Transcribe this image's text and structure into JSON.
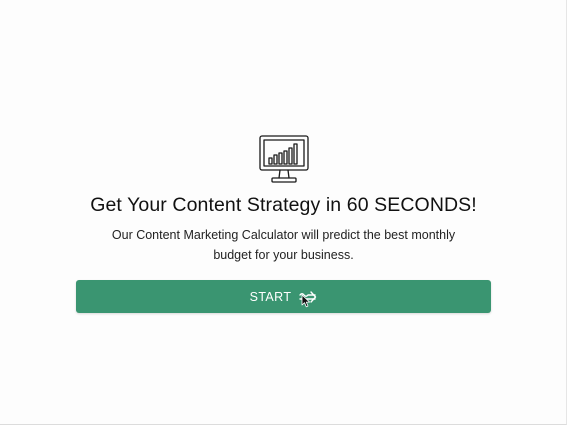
{
  "hero": {
    "icon": "monitor-chart-icon",
    "headline": "Get Your Content Strategy in 60 SECONDS!",
    "subtext": "Our Content Marketing Calculator will predict the best monthly budget for your business."
  },
  "start_button": {
    "label": "START",
    "icon": "arrow-right-icon",
    "color": "#3a9571"
  },
  "cursor": {
    "icon": "mouse-pointer-icon"
  }
}
